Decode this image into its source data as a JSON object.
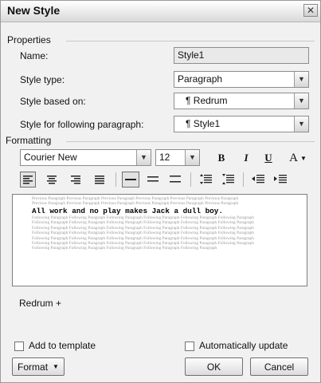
{
  "dialog": {
    "title": "New Style"
  },
  "properties": {
    "legend": "Properties",
    "name_label": "Name:",
    "name_value": "Style1",
    "type_label": "Style type:",
    "type_value": "Paragraph",
    "based_label": "Style based on:",
    "based_value": "¶ Redrum",
    "following_label": "Style for following paragraph:",
    "following_value": "¶ Style1"
  },
  "formatting": {
    "legend": "Formatting",
    "font": "Courier New",
    "size": "12",
    "bold": "B",
    "italic": "I",
    "underline": "U",
    "font_color": "A"
  },
  "preview": {
    "previous_lines": [
      "Previous Paragraph Previous Paragraph Previous Paragraph Previous Paragraph Previous Paragraph Previous Paragraph",
      "Previous Paragraph Previous Paragraph Previous Paragraph Previous Paragraph Previous Paragraph Previous Paragraph"
    ],
    "sample_text": "All work and no play makes Jack a dull boy.",
    "following_lines": [
      "Following Paragraph Following Paragraph Following Paragraph Following Paragraph Following Paragraph Following Paragraph",
      "Following Paragraph Following Paragraph Following Paragraph Following Paragraph Following Paragraph Following Paragraph",
      "Following Paragraph Following Paragraph Following Paragraph Following Paragraph Following Paragraph Following Paragraph",
      "Following Paragraph Following Paragraph Following Paragraph Following Paragraph Following Paragraph Following Paragraph",
      "Following Paragraph Following Paragraph Following Paragraph Following Paragraph Following Paragraph Following Paragraph",
      "Following Paragraph Following Paragraph Following Paragraph Following Paragraph Following Paragraph Following Paragraph",
      "Following Paragraph Following Paragraph Following Paragraph Following Paragraph Following Paragraph"
    ]
  },
  "description": "Redrum +",
  "options": {
    "add_to_template": "Add to template",
    "auto_update": "Automatically update"
  },
  "buttons": {
    "format": "Format",
    "ok": "OK",
    "cancel": "Cancel"
  }
}
